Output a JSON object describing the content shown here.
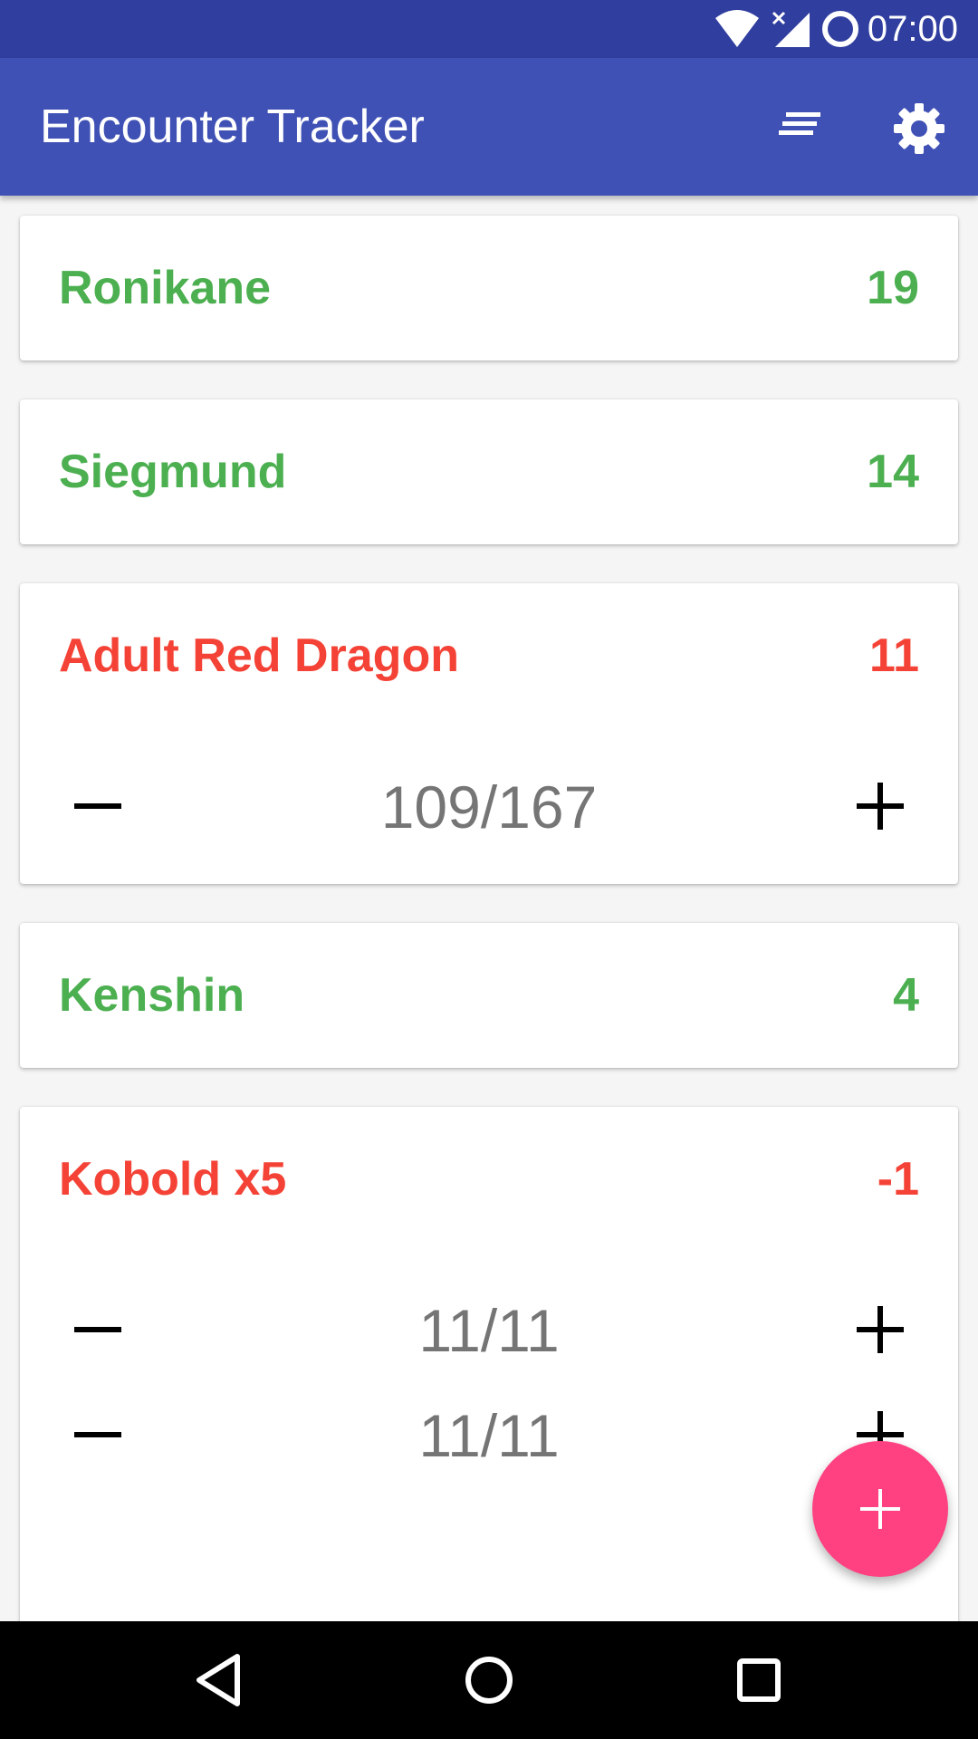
{
  "status_bar": {
    "time": "07:00",
    "icons": [
      "wifi-icon",
      "signal-off-icon",
      "circle-status-icon"
    ]
  },
  "app_bar": {
    "title": "Encounter Tracker",
    "actions": [
      "sort-icon",
      "settings-gear-icon"
    ]
  },
  "colors": {
    "primary": "#3f51b5",
    "primary_dark": "#303f9f",
    "accent": "#ff4081",
    "player": "#4caf50",
    "monster": "#f44336",
    "hp_text": "#757575"
  },
  "combatants": [
    {
      "name": "Ronikane",
      "initiative": "19",
      "kind": "player"
    },
    {
      "name": "Siegmund",
      "initiative": "14",
      "kind": "player"
    },
    {
      "name": "Adult Red Dragon",
      "initiative": "11",
      "kind": "monster",
      "hp": [
        "109/167"
      ]
    },
    {
      "name": "Kenshin",
      "initiative": "4",
      "kind": "player"
    },
    {
      "name": "Kobold x5",
      "initiative": "-1",
      "kind": "monster",
      "hp": [
        "11/11",
        "11/11"
      ]
    }
  ],
  "fab": {
    "icon": "add-icon"
  },
  "nav_bar": {
    "buttons": [
      "back-icon",
      "home-icon",
      "recents-icon"
    ]
  }
}
